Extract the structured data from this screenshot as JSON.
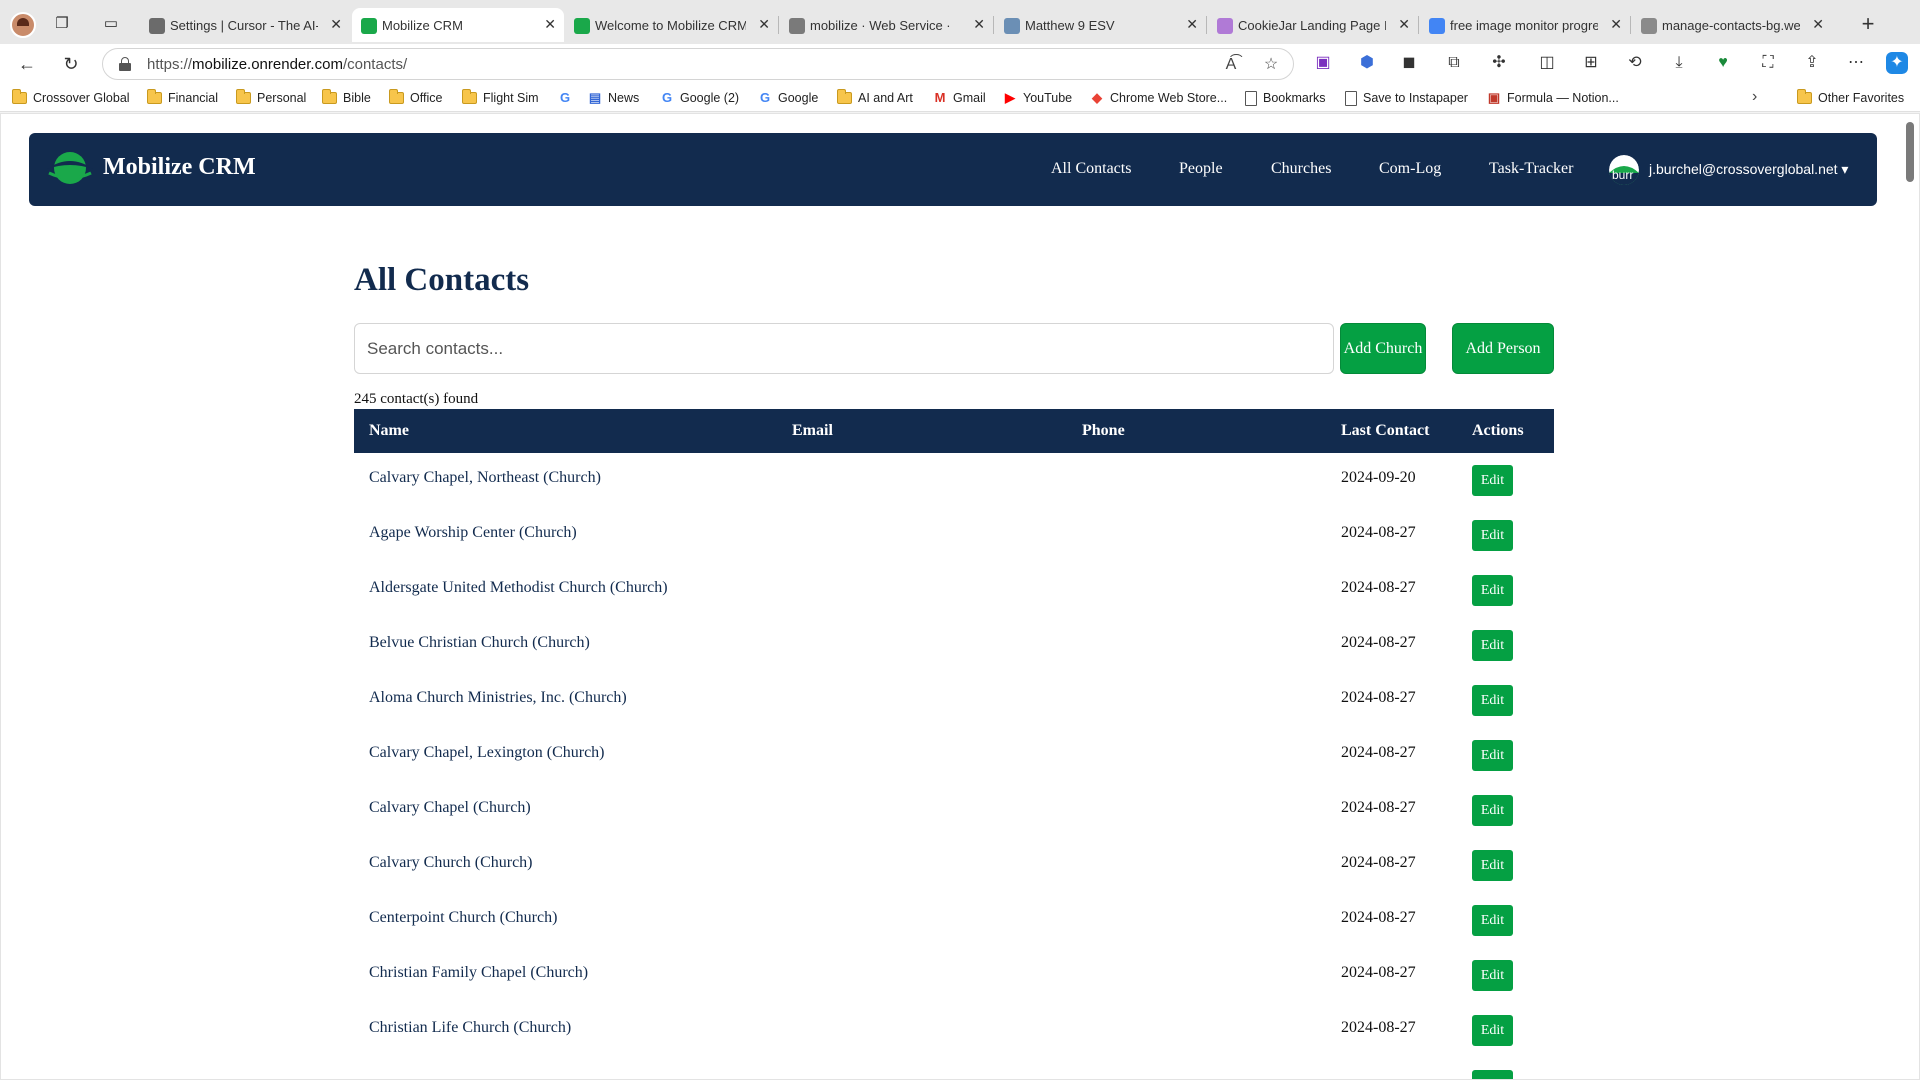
{
  "browser": {
    "tabs": [
      {
        "title": "Settings | Cursor - The AI-",
        "favicon_color": "#6b6b6b"
      },
      {
        "title": "Mobilize CRM",
        "favicon_color": "#1aa84a",
        "active": true
      },
      {
        "title": "Welcome to Mobilize CRM",
        "favicon_color": "#1aa84a"
      },
      {
        "title": "mobilize · Web Service ·",
        "favicon_color": "#7a7a7a"
      },
      {
        "title": "Matthew 9 ESV",
        "favicon_color": "#6b8fb5"
      },
      {
        "title": "CookieJar Landing Page In",
        "favicon_color": "#b07ad6"
      },
      {
        "title": "free image monitor progre",
        "favicon_color": "#4285f4"
      },
      {
        "title": "manage-contacts-bg.webp",
        "favicon_color": "#8a8a8a"
      }
    ],
    "url_scheme": "https://",
    "url_host": "mobilize.onrender.com",
    "url_path": "/contacts/",
    "bookmarks": [
      {
        "label": "Crossover Global",
        "icon": "folder-icon"
      },
      {
        "label": "Financial",
        "icon": "folder-icon"
      },
      {
        "label": "Personal",
        "icon": "folder-icon"
      },
      {
        "label": "Bible",
        "icon": "folder-icon"
      },
      {
        "label": "Office",
        "icon": "folder-icon"
      },
      {
        "label": "Flight Sim",
        "icon": "folder-icon"
      },
      {
        "label": "",
        "icon": "google-icon"
      },
      {
        "label": "News",
        "icon": "news-icon"
      },
      {
        "label": "Google (2)",
        "icon": "google-icon"
      },
      {
        "label": "Google",
        "icon": "google-icon"
      },
      {
        "label": "AI and Art",
        "icon": "folder-icon"
      },
      {
        "label": "Gmail",
        "icon": "gmail-icon"
      },
      {
        "label": "YouTube",
        "icon": "youtube-icon"
      },
      {
        "label": "Chrome Web Store...",
        "icon": "chrome-store-icon"
      },
      {
        "label": "Bookmarks",
        "icon": "page-icon"
      },
      {
        "label": "Save to Instapaper",
        "icon": "page-icon"
      },
      {
        "label": "Formula — Notion...",
        "icon": "notion-icon"
      }
    ],
    "other_favorites": "Other Favorites"
  },
  "app": {
    "brand": "Mobilize CRM",
    "nav": [
      "All Contacts",
      "People",
      "Churches",
      "Com-Log",
      "Task-Tracker"
    ],
    "user_avatar_text": "burr",
    "user_email": "j.burchel@crossoverglobal.net ▾",
    "colors": {
      "navy": "#122b4e",
      "green": "#05a043"
    }
  },
  "page": {
    "title": "All Contacts",
    "search_placeholder": "Search contacts...",
    "add_church": "Add Church",
    "add_person": "Add Person",
    "result_count": "245 contact(s) found"
  },
  "table": {
    "headers": [
      "Name",
      "Email",
      "Phone",
      "Last Contact",
      "Actions"
    ],
    "edit_label": "Edit",
    "rows": [
      {
        "name": "Calvary Chapel, Northeast (Church)",
        "email": "",
        "phone": "",
        "last_contact": "2024-09-20"
      },
      {
        "name": "Agape Worship Center (Church)",
        "email": "",
        "phone": "",
        "last_contact": "2024-08-27"
      },
      {
        "name": "Aldersgate United Methodist Church (Church)",
        "email": "",
        "phone": "",
        "last_contact": "2024-08-27"
      },
      {
        "name": "Belvue Christian Church (Church)",
        "email": "",
        "phone": "",
        "last_contact": "2024-08-27"
      },
      {
        "name": "Aloma Church Ministries, Inc. (Church)",
        "email": "",
        "phone": "",
        "last_contact": "2024-08-27"
      },
      {
        "name": "Calvary Chapel, Lexington (Church)",
        "email": "",
        "phone": "",
        "last_contact": "2024-08-27"
      },
      {
        "name": "Calvary Chapel (Church)",
        "email": "",
        "phone": "",
        "last_contact": "2024-08-27"
      },
      {
        "name": "Calvary Church (Church)",
        "email": "",
        "phone": "",
        "last_contact": "2024-08-27"
      },
      {
        "name": "Centerpoint Church (Church)",
        "email": "",
        "phone": "",
        "last_contact": "2024-08-27"
      },
      {
        "name": "Christian Family Chapel (Church)",
        "email": "",
        "phone": "",
        "last_contact": "2024-08-27"
      },
      {
        "name": "Christian Life Church (Church)",
        "email": "",
        "phone": "",
        "last_contact": "2024-08-27"
      }
    ]
  }
}
